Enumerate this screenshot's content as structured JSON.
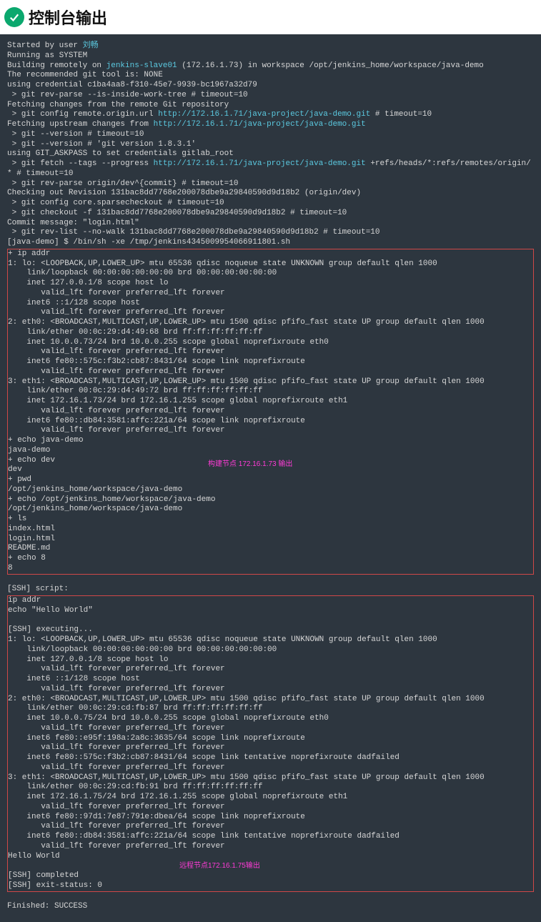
{
  "header": {
    "title": "控制台输出"
  },
  "console": {
    "pre1": "Started by user ",
    "userLink": "刘畅",
    "pre2": "\nRunning as SYSTEM\nBuilding remotely on ",
    "slaveLink": "jenkins-slave01",
    "pre3": " (172.16.1.73) in workspace /opt/jenkins_home/workspace/java-demo\nThe recommended git tool is: NONE\nusing credential c1ba4aa8-f310-45e7-9939-bc1967a32d79\n > git rev-parse --is-inside-work-tree # timeout=10\nFetching changes from the remote Git repository\n > git config remote.origin.url ",
    "repoLink1": "http://172.16.1.71/java-project/java-demo.git",
    "pre4": " # timeout=10\nFetching upstream changes from ",
    "repoLink2": "http://172.16.1.71/java-project/java-demo.git",
    "pre5": "\n > git --version # timeout=10\n > git --version # 'git version 1.8.3.1'\nusing GIT_ASKPASS to set credentials gitlab_root\n > git fetch --tags --progress ",
    "repoLink3": "http://172.16.1.71/java-project/java-demo.git",
    "pre6": " +refs/heads/*:refs/remotes/origin/* # timeout=10\n > git rev-parse origin/dev^{commit} # timeout=10\nChecking out Revision 131bac8dd7768e200078dbe9a29840590d9d18b2 (origin/dev)\n > git config core.sparsecheckout # timeout=10\n > git checkout -f 131bac8dd7768e200078dbe9a29840590d9d18b2 # timeout=10\nCommit message: \"login.html\"\n > git rev-list --no-walk 131bac8dd7768e200078dbe9a29840590d9d18b2 # timeout=10\n[java-demo] $ /bin/sh -xe /tmp/jenkins4345009954066911801.sh",
    "box1": "+ ip addr\n1: lo: <LOOPBACK,UP,LOWER_UP> mtu 65536 qdisc noqueue state UNKNOWN group default qlen 1000\n    link/loopback 00:00:00:00:00:00 brd 00:00:00:00:00:00\n    inet 127.0.0.1/8 scope host lo\n       valid_lft forever preferred_lft forever\n    inet6 ::1/128 scope host\n       valid_lft forever preferred_lft forever\n2: eth0: <BROADCAST,MULTICAST,UP,LOWER_UP> mtu 1500 qdisc pfifo_fast state UP group default qlen 1000\n    link/ether 00:0c:29:d4:49:68 brd ff:ff:ff:ff:ff:ff\n    inet 10.0.0.73/24 brd 10.0.0.255 scope global noprefixroute eth0\n       valid_lft forever preferred_lft forever\n    inet6 fe80::575c:f3b2:cb87:8431/64 scope link noprefixroute\n       valid_lft forever preferred_lft forever\n3: eth1: <BROADCAST,MULTICAST,UP,LOWER_UP> mtu 1500 qdisc pfifo_fast state UP group default qlen 1000\n    link/ether 00:0c:29:d4:49:72 brd ff:ff:ff:ff:ff:ff\n    inet 172.16.1.73/24 brd 172.16.1.255 scope global noprefixroute eth1\n       valid_lft forever preferred_lft forever\n    inet6 fe80::db84:3581:affc:221a/64 scope link noprefixroute\n       valid_lft forever preferred_lft forever\n+ echo java-demo\njava-demo\n+ echo dev\ndev\n+ pwd\n/opt/jenkins_home/workspace/java-demo\n+ echo /opt/jenkins_home/workspace/java-demo\n/opt/jenkins_home/workspace/java-demo\n+ ls\nindex.html\nlogin.html\nREADME.md\n+ echo 8\n8",
    "mid": "[SSH] script:",
    "box2": "ip addr\necho \"Hello World\"\n\n[SSH] executing...\n1: lo: <LOOPBACK,UP,LOWER_UP> mtu 65536 qdisc noqueue state UNKNOWN group default qlen 1000\n    link/loopback 00:00:00:00:00:00 brd 00:00:00:00:00:00\n    inet 127.0.0.1/8 scope host lo\n       valid_lft forever preferred_lft forever\n    inet6 ::1/128 scope host\n       valid_lft forever preferred_lft forever\n2: eth0: <BROADCAST,MULTICAST,UP,LOWER_UP> mtu 1500 qdisc pfifo_fast state UP group default qlen 1000\n    link/ether 00:0c:29:cd:fb:87 brd ff:ff:ff:ff:ff:ff\n    inet 10.0.0.75/24 brd 10.0.0.255 scope global noprefixroute eth0\n       valid_lft forever preferred_lft forever\n    inet6 fe80::e95f:198a:2a8c:3635/64 scope link noprefixroute\n       valid_lft forever preferred_lft forever\n    inet6 fe80::575c:f3b2:cb87:8431/64 scope link tentative noprefixroute dadfailed\n       valid_lft forever preferred_lft forever\n3: eth1: <BROADCAST,MULTICAST,UP,LOWER_UP> mtu 1500 qdisc pfifo_fast state UP group default qlen 1000\n    link/ether 00:0c:29:cd:fb:91 brd ff:ff:ff:ff:ff:ff\n    inet 172.16.1.75/24 brd 172.16.1.255 scope global noprefixroute eth1\n       valid_lft forever preferred_lft forever\n    inet6 fe80::97d1:7e87:791e:dbea/64 scope link noprefixroute\n       valid_lft forever preferred_lft forever\n    inet6 fe80::db84:3581:affc:221a/64 scope link tentative noprefixroute dadfailed\n       valid_lft forever preferred_lft forever\nHello World\n\n[SSH] completed\n[SSH] exit-status: 0",
    "post": "\nFinished: SUCCESS",
    "annotation1": "构建节点 172.16.1.73 输出",
    "annotation2": "远程节点172.16.1.75输出"
  }
}
